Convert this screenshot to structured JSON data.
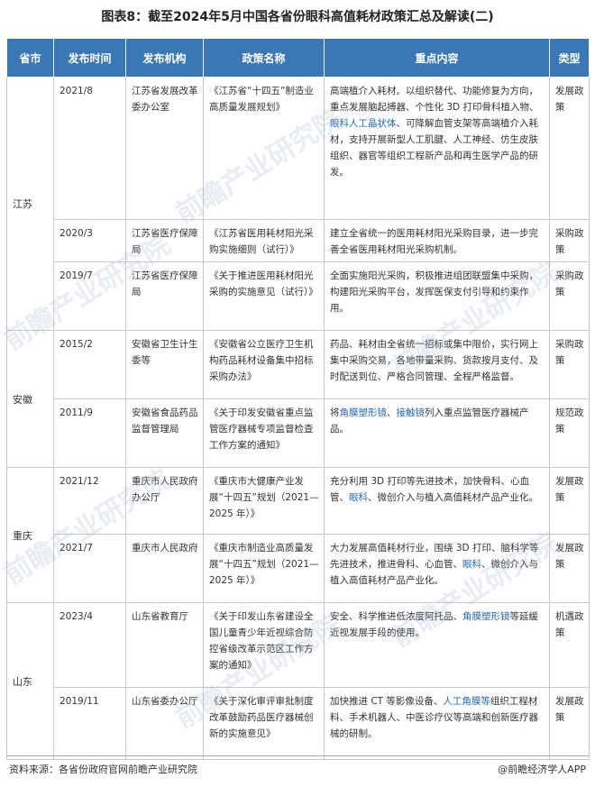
{
  "title": "图表8：截至2024年5月中国各省份眼科高值耗材政策汇总及解读(二)",
  "headers": [
    "省市",
    "发布时间",
    "发布机构",
    "政策名称",
    "重点内容",
    "类型"
  ],
  "groups": [
    {
      "province": "江苏",
      "rows": [
        {
          "date": "2021/8",
          "org": "江苏省发展改革委办公室",
          "policy": "《江苏省“十四五”制造业高质量发展规划》",
          "content": [
            {
              "t": "高端植介入耗材。以组织替代、功能修复为方向，重点发展脑起搏器、个性化 3D 打印骨科植入物、"
            },
            {
              "t": "眼科人工晶状体",
              "hl": true
            },
            {
              "t": "、可降解血管支架等高端植介入耗材，支持开展新型人工肌腱、人工神经、仿生皮肤组织、器官等组织工程新产品和再生医学产品的研发。"
            }
          ],
          "type": "发展政策"
        },
        {
          "date": "2020/3",
          "org": "江苏省医疗保障局",
          "policy": "《江苏省医用耗材阳光采购实施细则（试行）》",
          "content": [
            {
              "t": "建立全省统一的医用耗材阳光采购目录，进一步完善全省医用耗材阳光采购机制。"
            }
          ],
          "type": "采购政策"
        },
        {
          "date": "2019/7",
          "org": "江苏省医疗保障局",
          "policy": "《关于推进医用耗材阳光采购的实施意见（试行）》",
          "content": [
            {
              "t": "全面实施阳光采购，积极推进组团联盟集中采购，构建阳光采购平台，发挥医保支付引导和约束作用。"
            }
          ],
          "type": "采购政策"
        }
      ]
    },
    {
      "province": "安徽",
      "rows": [
        {
          "date": "2015/2",
          "org": "安徽省卫生计生委等",
          "policy": "《安徽省公立医疗卫生机构药品耗材设备集中招标采购办法》",
          "content": [
            {
              "t": "药品、耗材由全省统一招标或集中限价，实行网上集中采购交易，各地带量采购、货款按月支付、及时配送到位、严格合同管理、全程严格监督。"
            }
          ],
          "type": "采购政策"
        },
        {
          "date": "2011/9",
          "org": "安徽省食品药品监督管理局",
          "policy": "《关于印发安徽省重点监管医疗器械专项监督检查工作方案的通知》",
          "content": [
            {
              "t": "将"
            },
            {
              "t": "角膜塑形镜",
              "hl": true
            },
            {
              "t": "、"
            },
            {
              "t": "接触镜",
              "hl": true
            },
            {
              "t": "列入重点监管医疗器械产品。"
            }
          ],
          "type": "规范政策"
        }
      ]
    },
    {
      "province": "重庆",
      "rows": [
        {
          "date": "2021/12",
          "org": "重庆市人民政府办公厅",
          "policy": "《重庆市大健康产业发展“十四五”规划（2021—2025 年）》",
          "content": [
            {
              "t": "充分利用 3D 打印等先进技术，加快骨科、心血管、"
            },
            {
              "t": "眼科",
              "hl": true
            },
            {
              "t": "、微创介入与植入高值耗材产品产业化。"
            }
          ],
          "type": "发展政策"
        },
        {
          "date": "2021/7",
          "org": "重庆市人民政府",
          "policy": "《重庆市制造业高质量发展“十四五”规划（2021—2025 年）》",
          "content": [
            {
              "t": "大力发展高值耗材行业，围绕 3D 打印、脑科学等先进技术，推进骨科、心血管、"
            },
            {
              "t": "眼科",
              "hl": true
            },
            {
              "t": "、微创介入与植入高值耗材产品产业化。"
            }
          ],
          "type": "发展政策"
        }
      ]
    },
    {
      "province": "山东",
      "rows": [
        {
          "date": "2023/4",
          "org": "山东省教育厅",
          "policy": "《关于印发山东省建设全国儿童青少年近视综合防控省级改革示范区工作方案的通知》",
          "content": [
            {
              "t": "安全、科学推进低浓度阿托品、"
            },
            {
              "t": "角膜塑形镜",
              "hl": true
            },
            {
              "t": "等延缓近视发展手段的使用。"
            }
          ],
          "type": "机遇政策"
        },
        {
          "date": "2019/11",
          "org": "山东省委办公厅",
          "policy": "《关于深化审评审批制度改革鼓励药品医疗器械创新的实施意见》",
          "content": [
            {
              "t": "加快推进 CT 等影像设备、"
            },
            {
              "t": "人工角膜等",
              "hl": true
            },
            {
              "t": "组织工程材料、手术机器人、中医诊疗仪等高端和创新医疗器械的研制。"
            }
          ],
          "type": "发展政策"
        }
      ]
    }
  ],
  "footer": {
    "source": "资料来源：各省份政府官网前瞻产业研究院",
    "brand": "@前瞻经济学人APP"
  },
  "watermark": "前瞻产业研究院",
  "colors": {
    "header_bg": "#3a78b5",
    "highlight": "#2268b8"
  }
}
